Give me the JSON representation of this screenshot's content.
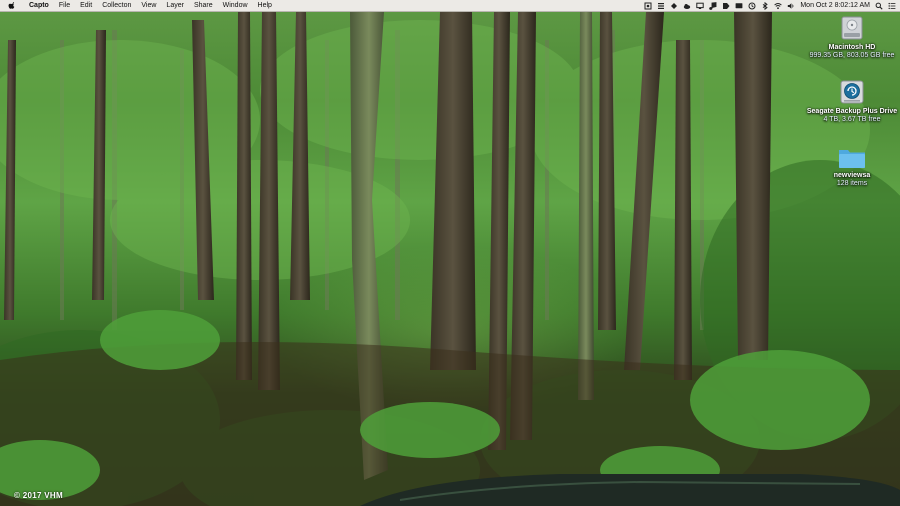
{
  "menubar": {
    "app_name": "Capto",
    "items": [
      "File",
      "Edit",
      "Collecton",
      "View",
      "Layer",
      "Share",
      "Window",
      "Help"
    ],
    "status_icons": [
      "capture-icon",
      "list-icon",
      "wifi-fan-icon",
      "cloud-icon",
      "screen-icon",
      "music-icon",
      "tag-icon",
      "display-icon",
      "backup-icon",
      "bluetooth-icon",
      "wifi-icon",
      "volume-icon"
    ],
    "clock": "Mon Oct 2  8:02:12 AM"
  },
  "desktop": {
    "items": [
      {
        "name": "Macintosh HD",
        "info": "999.35 GB, 803.05 GB free",
        "icon": "hard-drive-icon"
      },
      {
        "name": "Seagate Backup Plus Drive",
        "info": "4 TB, 3.67 TB free",
        "icon": "external-drive-icon"
      },
      {
        "name": "newviewsa",
        "info": "128 items",
        "icon": "folder-icon"
      }
    ]
  },
  "watermark": "© 2017 VHM",
  "colors": {
    "menubar": "#eceae6",
    "folder": "#5ab6e8",
    "foliage": "#4d8a36"
  }
}
